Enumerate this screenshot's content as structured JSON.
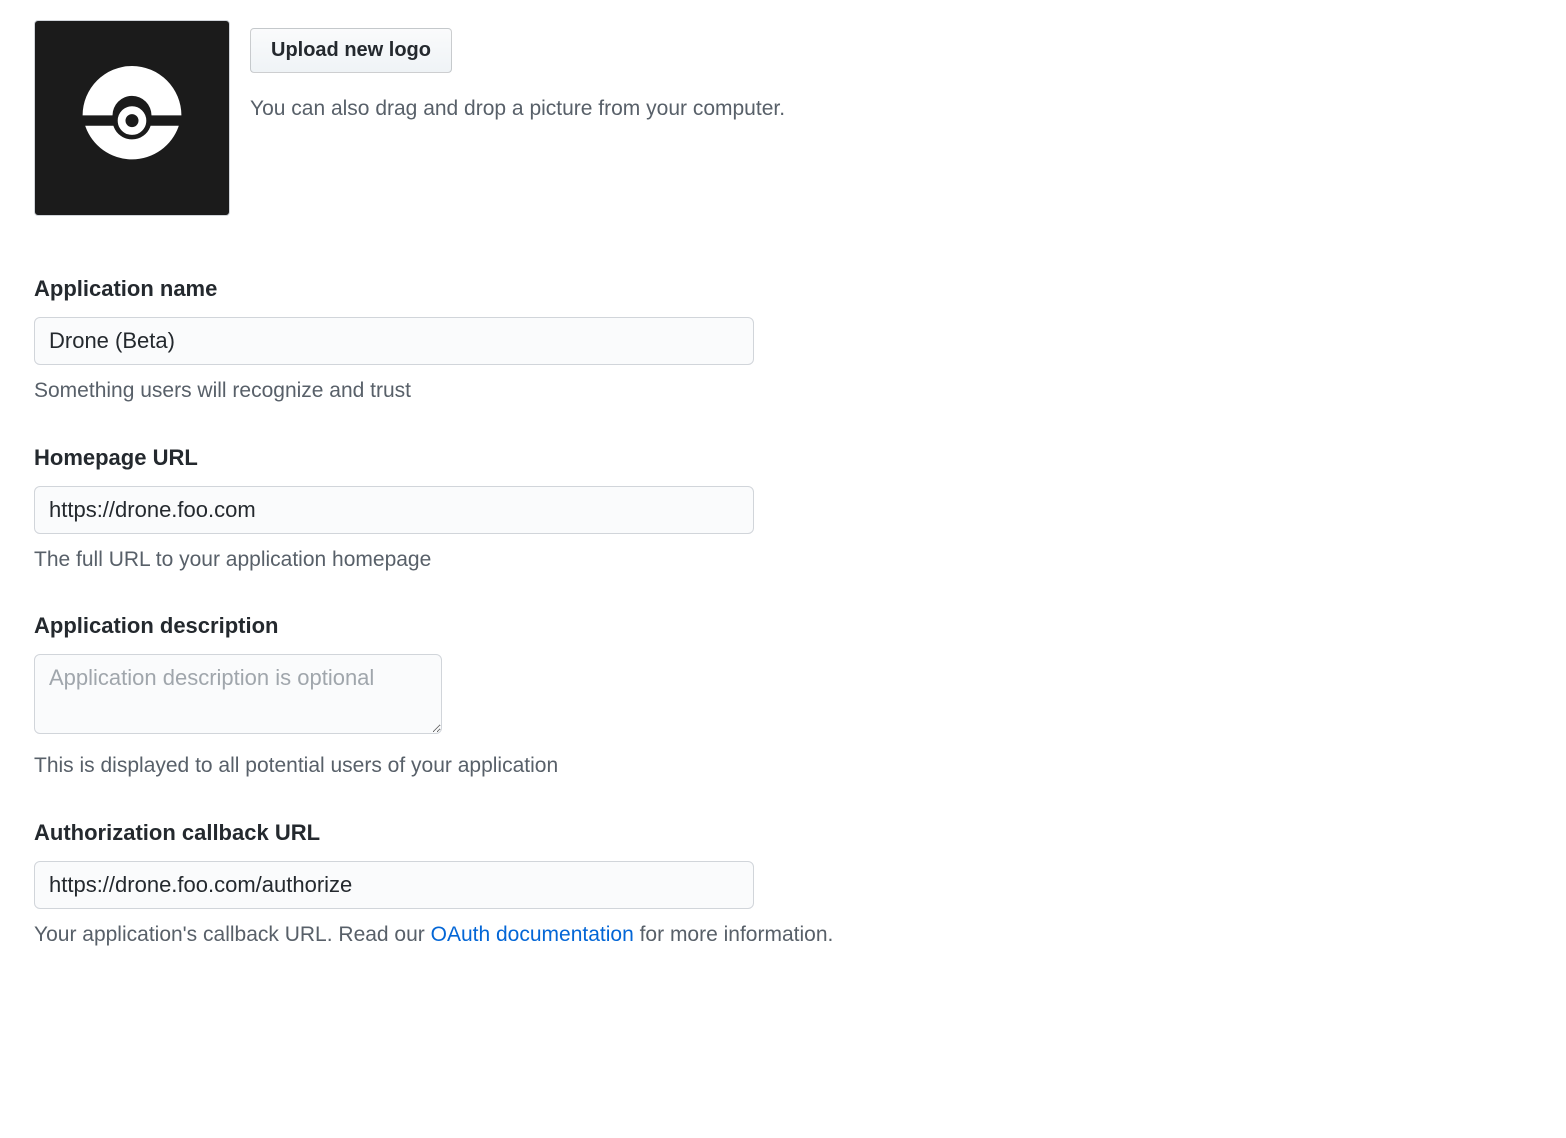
{
  "logo": {
    "upload_button_label": "Upload new logo",
    "drag_hint": "You can also drag and drop a picture from your computer."
  },
  "fields": {
    "app_name": {
      "label": "Application name",
      "value": "Drone (Beta)",
      "help": "Something users will recognize and trust"
    },
    "homepage_url": {
      "label": "Homepage URL",
      "value": "https://drone.foo.com",
      "help": "The full URL to your application homepage"
    },
    "app_description": {
      "label": "Application description",
      "value": "",
      "placeholder": "Application description is optional",
      "help": "This is displayed to all potential users of your application"
    },
    "callback_url": {
      "label": "Authorization callback URL",
      "value": "https://drone.foo.com/authorize",
      "help_pre": "Your application's callback URL. Read our ",
      "help_link": "OAuth documentation",
      "help_post": " for more information."
    }
  }
}
